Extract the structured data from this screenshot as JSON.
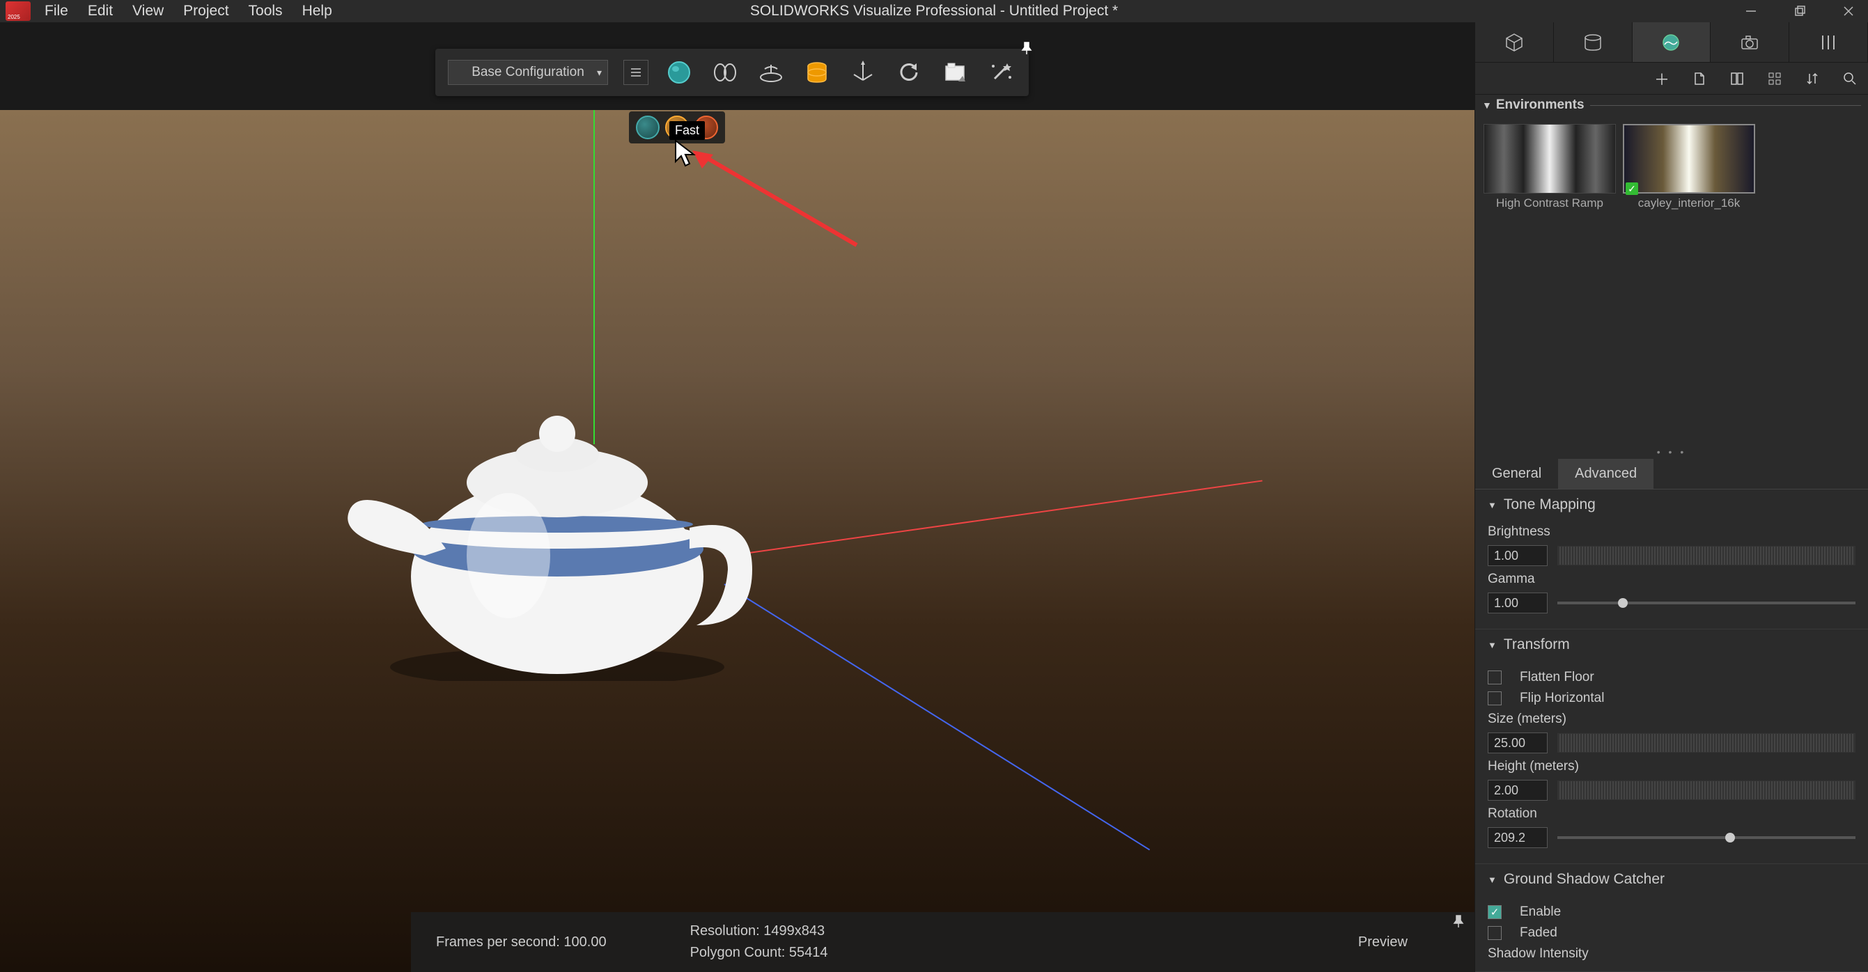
{
  "app": {
    "title": "SOLIDWORKS Visualize Professional - Untitled Project *"
  },
  "menu": {
    "file": "File",
    "edit": "Edit",
    "view": "View",
    "project": "Project",
    "tools": "Tools",
    "help": "Help"
  },
  "toolbar": {
    "config_label": "Base Configuration"
  },
  "render_modes": {
    "tooltip_fast": "Fast"
  },
  "status": {
    "fps_label": "Frames per second:",
    "fps_value": "100.00",
    "resolution_label": "Resolution:",
    "resolution_value": "1499x843",
    "polycount_label": "Polygon Count:",
    "polycount_value": "55414",
    "mode": "Preview"
  },
  "panel": {
    "environments_header": "Environments",
    "env_items": [
      {
        "label": "High Contrast Ramp"
      },
      {
        "label": "cayley_interior_16k"
      }
    ],
    "tabs": {
      "general": "General",
      "advanced": "Advanced"
    },
    "tone_mapping": {
      "header": "Tone Mapping",
      "brightness_label": "Brightness",
      "brightness_value": "1.00",
      "gamma_label": "Gamma",
      "gamma_value": "1.00"
    },
    "transform": {
      "header": "Transform",
      "flatten_floor": "Flatten Floor",
      "flip_horizontal": "Flip Horizontal",
      "size_label": "Size (meters)",
      "size_value": "25.00",
      "height_label": "Height (meters)",
      "height_value": "2.00",
      "rotation_label": "Rotation",
      "rotation_value": "209.2"
    },
    "shadow": {
      "header": "Ground Shadow Catcher",
      "enable": "Enable",
      "faded": "Faded",
      "intensity_label": "Shadow Intensity"
    }
  }
}
